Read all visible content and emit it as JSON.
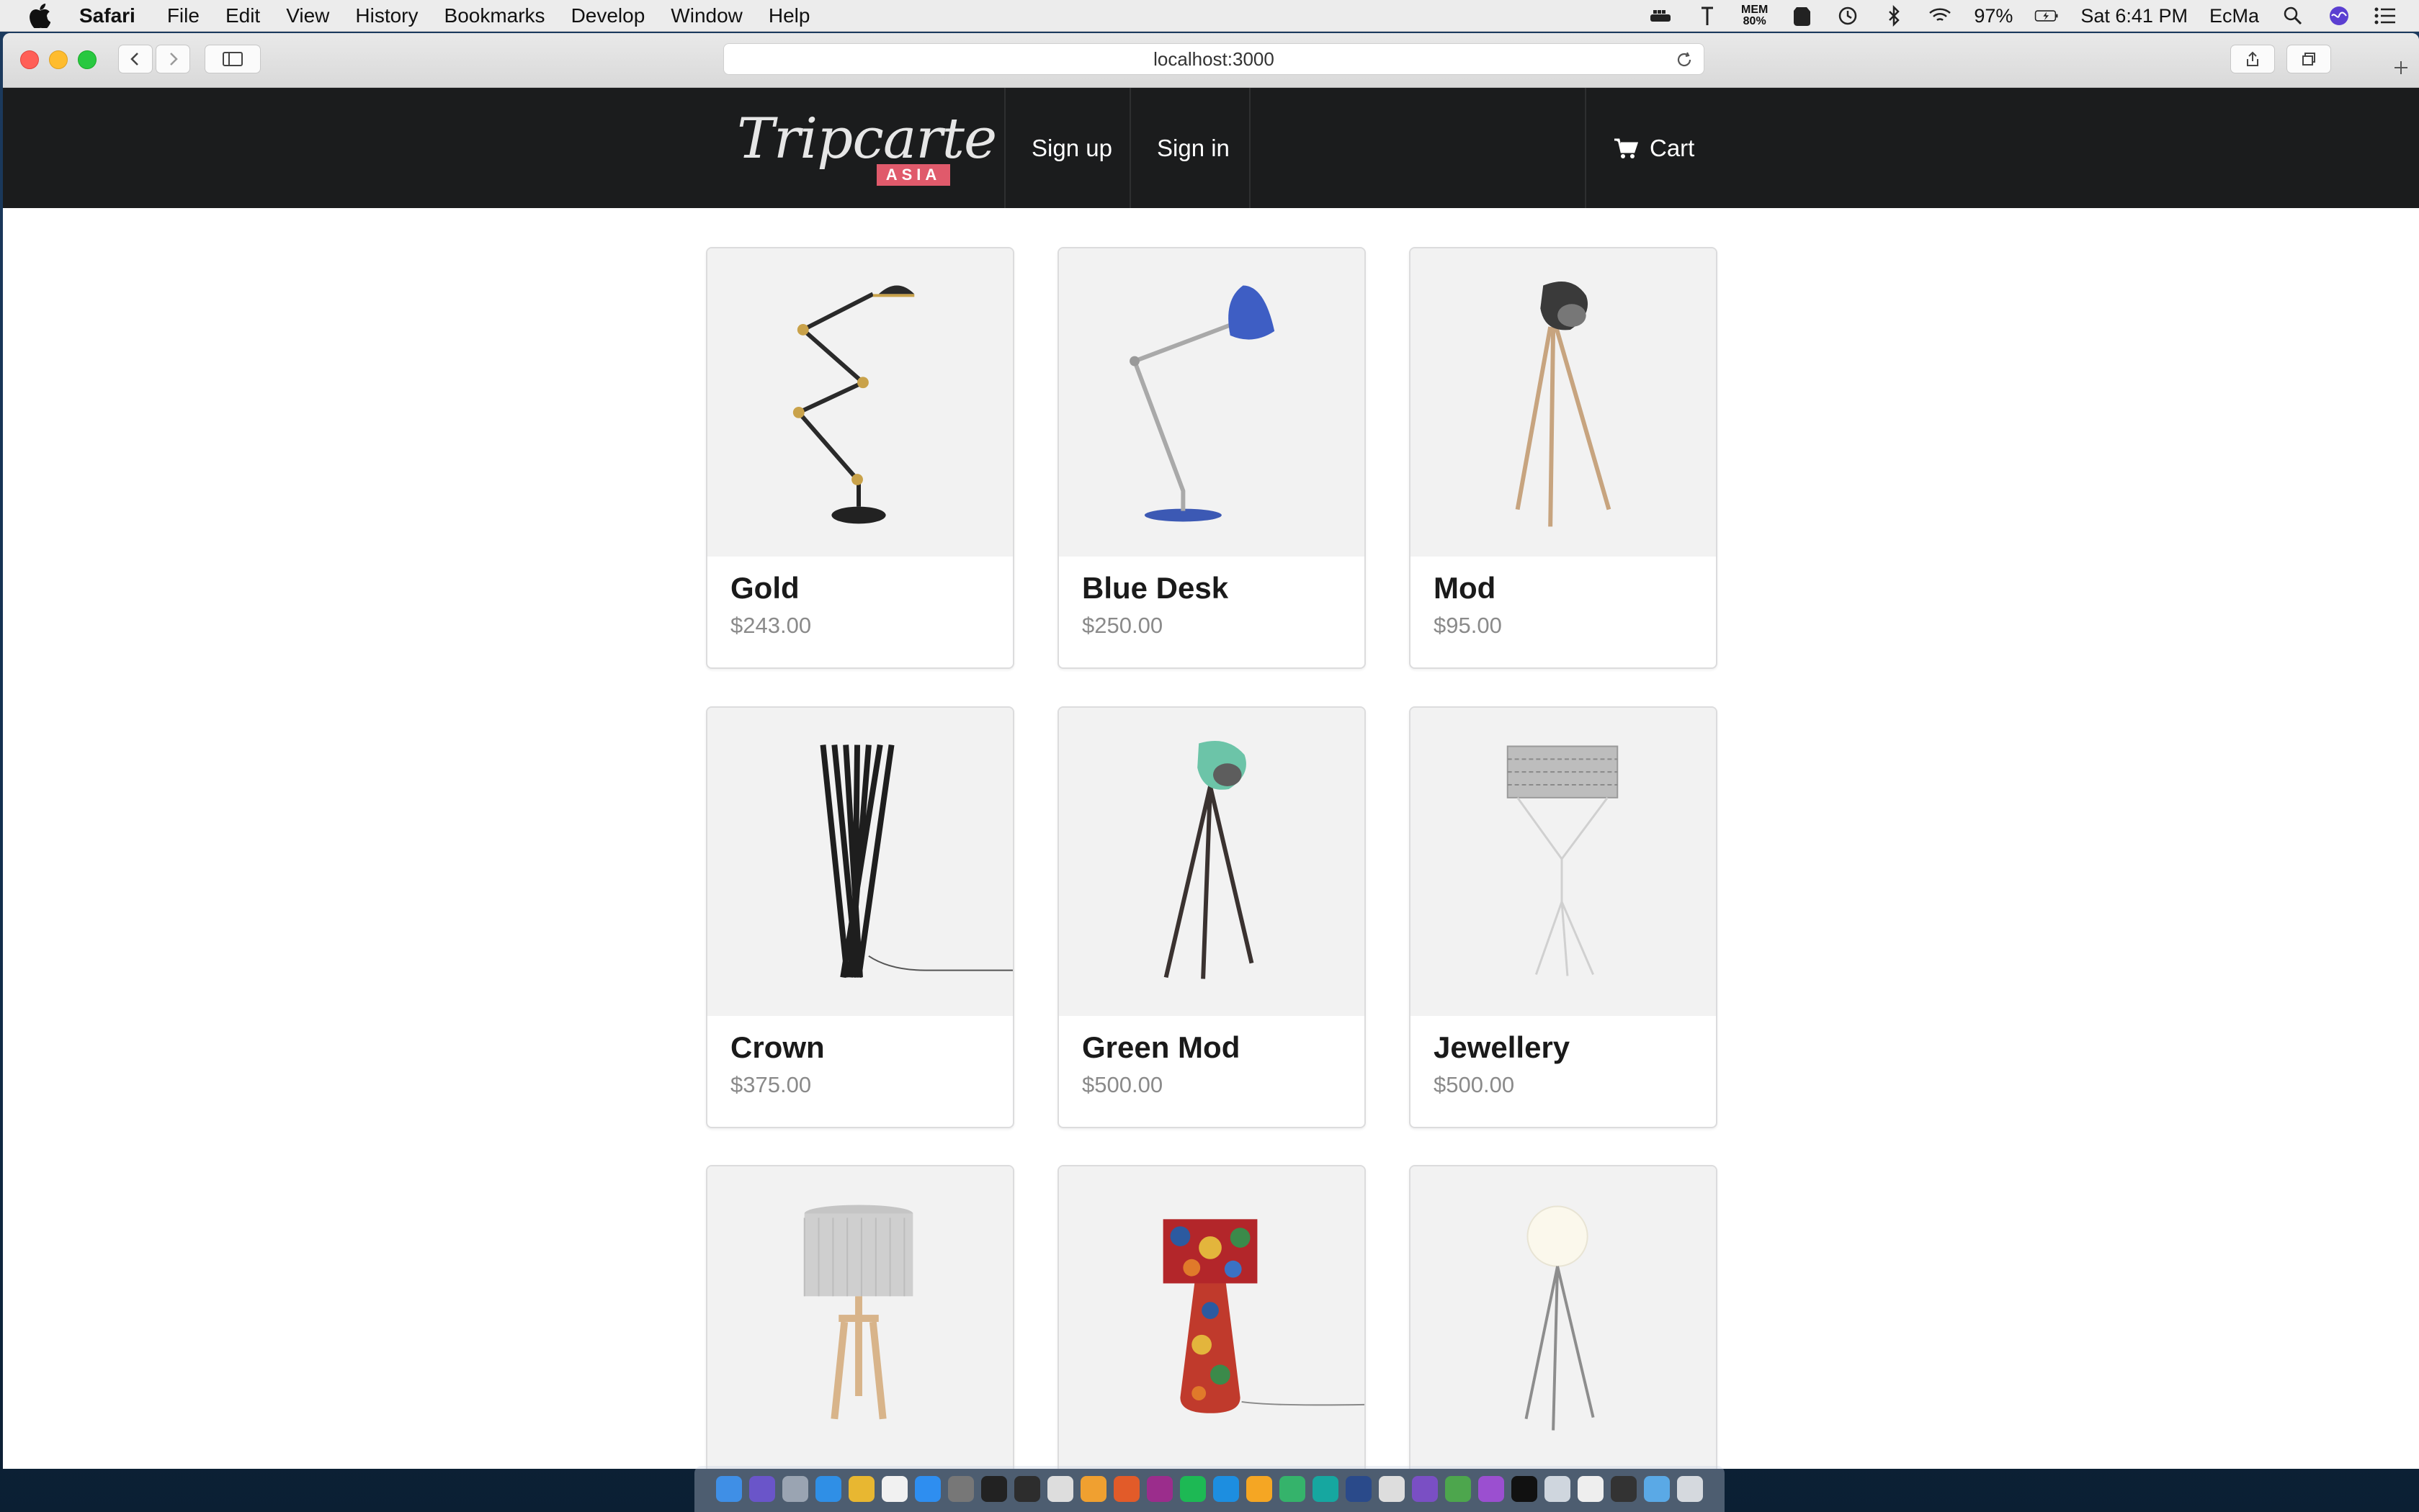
{
  "menubar": {
    "app": "Safari",
    "items": [
      "File",
      "Edit",
      "View",
      "History",
      "Bookmarks",
      "Develop",
      "Window",
      "Help"
    ],
    "mem_label": "MEM",
    "mem_value": "80%",
    "battery": "97%",
    "clock": "Sat 6:41 PM",
    "user": "EcMa"
  },
  "browser": {
    "url": "localhost:3000"
  },
  "site": {
    "logo_text": "Tripcarte",
    "logo_badge": "ASIA",
    "nav": {
      "signup": "Sign up",
      "signin": "Sign in",
      "cart": "Cart"
    },
    "accent": "#e05a6b",
    "nav_bg": "#1b1c1d"
  },
  "products": [
    {
      "name": "Gold",
      "price": "$243.00",
      "icon": "gold-lamp-icon"
    },
    {
      "name": "Blue Desk",
      "price": "$250.00",
      "icon": "blue-desk-lamp-icon"
    },
    {
      "name": "Mod",
      "price": "$95.00",
      "icon": "mod-lamp-icon"
    },
    {
      "name": "Crown",
      "price": "$375.00",
      "icon": "crown-lamp-icon"
    },
    {
      "name": "Green Mod",
      "price": "$500.00",
      "icon": "green-mod-lamp-icon"
    },
    {
      "name": "Jewellery",
      "price": "$500.00",
      "icon": "jewellery-lamp-icon"
    },
    {
      "name": "",
      "price": "",
      "icon": "grey-shade-lamp-icon"
    },
    {
      "name": "",
      "price": "",
      "icon": "mosaic-lamp-icon"
    },
    {
      "name": "",
      "price": "",
      "icon": "globe-lamp-icon"
    }
  ]
}
